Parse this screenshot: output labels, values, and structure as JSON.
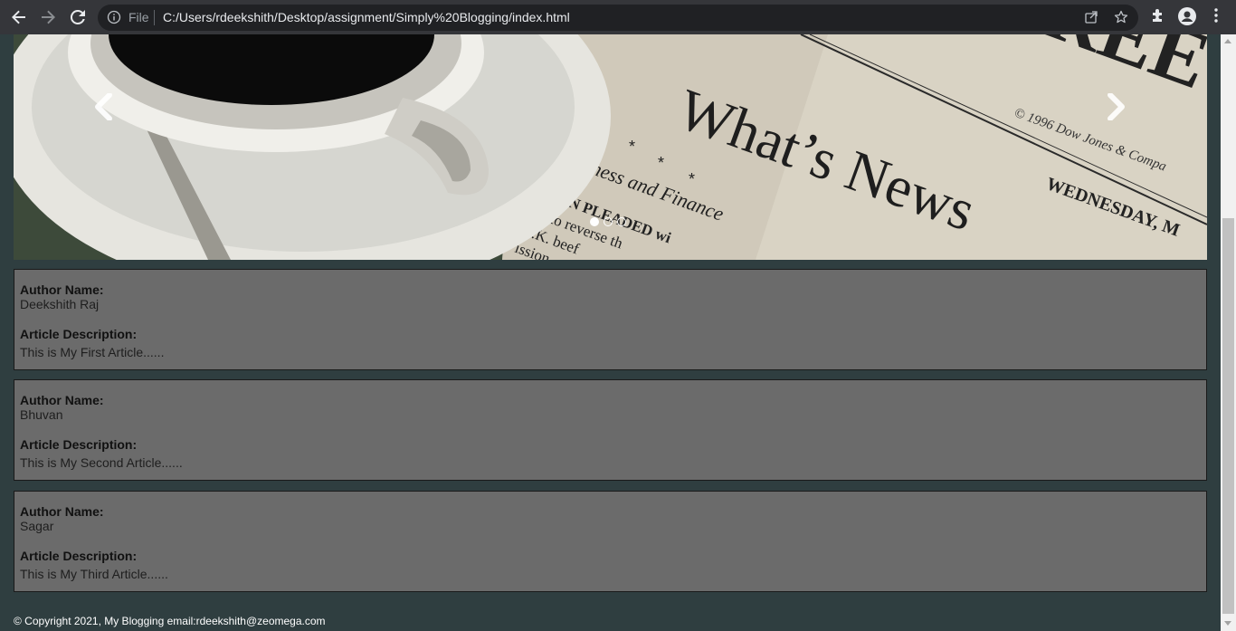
{
  "browser": {
    "scheme_label": "File",
    "url": "C:/Users/rdeekshith/Desktop/assignment/Simply%20Blogging/index.html"
  },
  "carousel": {
    "slides_count": 3,
    "active_slide": 1,
    "newspaper_text": {
      "headline": "What’s News",
      "section": "Business and Finance",
      "copyright": "© 1996 Dow Jones & Compa",
      "day": "WEDNESDAY, M",
      "masthead": "STREE",
      "snippet1": "TAIN PLEADED wi",
      "snippet2": "als to reverse th",
      "snippet3": "U.K. beef",
      "snippet4": "ission"
    }
  },
  "articles": [
    {
      "author_label": "Author Name:",
      "author": "Deekshith Raj",
      "desc_label": "Article Description:",
      "desc": "This is My First Article......"
    },
    {
      "author_label": "Author Name:",
      "author": "Bhuvan",
      "desc_label": "Article Description:",
      "desc": "This is My Second Article......"
    },
    {
      "author_label": "Author Name:",
      "author": "Sagar",
      "desc_label": "Article Description:",
      "desc": "This is My Third Article......"
    }
  ],
  "footer": {
    "text": "© Copyright 2021, My Blogging email:rdeekshith@zeomega.com"
  },
  "colors": {
    "page_bg": "#2f3e40",
    "card_bg": "#6b6b6b",
    "chrome_bg": "#35363a"
  }
}
